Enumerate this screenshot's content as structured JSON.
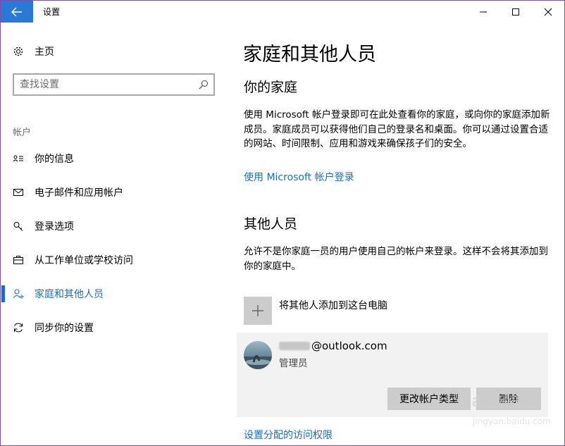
{
  "window": {
    "title": "设置"
  },
  "sidebar": {
    "home_label": "主页",
    "search_placeholder": "查找设置",
    "section_label": "帐户",
    "items": [
      {
        "label": "你的信息",
        "icon": "contact-card-icon"
      },
      {
        "label": "电子邮件和应用帐户",
        "icon": "mail-icon"
      },
      {
        "label": "登录选项",
        "icon": "key-icon"
      },
      {
        "label": "从工作单位或学校访问",
        "icon": "briefcase-icon"
      },
      {
        "label": "家庭和其他人员",
        "icon": "add-person-icon",
        "active": true
      },
      {
        "label": "同步你的设置",
        "icon": "sync-icon"
      }
    ]
  },
  "main": {
    "title": "家庭和其他人员",
    "family": {
      "heading": "你的家庭",
      "description": "使用 Microsoft 帐户登录即可在此处查看你的家庭，或向你的家庭添加新成员。家庭成员可以获得他们自己的登录名和桌面。你可以通过设置合适的网站、时间限制、应用和游戏来确保孩子们的安全。",
      "link": "使用 Microsoft 帐户登录"
    },
    "others": {
      "heading": "其他人员",
      "description": "允许不是你家庭一员的用户使用自己的帐户来登录。这样不会将其添加到你的家庭中。",
      "add_label": "将其他人添加到这台电脑",
      "account": {
        "email_suffix": "@outlook.com",
        "role": "管理员",
        "change_type_label": "更改帐户类型",
        "delete_label": "删除"
      },
      "access_link": "设置分配的访问权限"
    }
  },
  "watermark": {
    "brand": "Bai 经验",
    "url": "jingyan.baidu.com"
  },
  "colors": {
    "accent": "#1a6dc4",
    "back_button": "#2b79d6",
    "tile": "#cccccc",
    "card": "#f2f2f2"
  }
}
